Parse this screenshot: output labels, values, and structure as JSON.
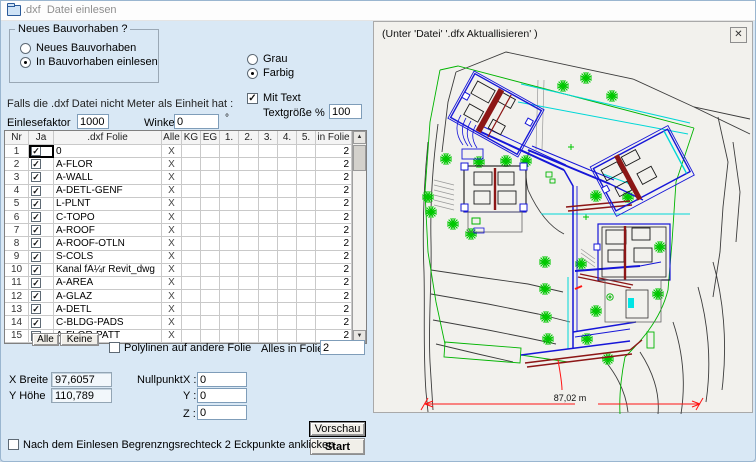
{
  "window": {
    "title": ".dxf  Datei einlesen"
  },
  "icons": {
    "check": "✓",
    "close": "✕",
    "scroll_up": "▲",
    "scroll_down": "▼",
    "folder": "folder-icon",
    "degree": "°"
  },
  "form": {
    "group_neues": {
      "legend": "Neues Bauvorhaben ?",
      "radio_neues": "Neues Bauvorhaben",
      "radio_einlesen": "In Bauvorhaben einlesen",
      "selected": "In Bauvorhaben einlesen"
    },
    "color": {
      "grau": "Grau",
      "farbig": "Farbig",
      "selected": "Farbig"
    },
    "mit_text": {
      "label": "Mit Text",
      "checked": true
    },
    "textgroesse": {
      "label": "Textgröße %",
      "value": "100"
    },
    "unit_note": "Falls die .dxf Datei nicht Meter als Einheit hat :",
    "einlesefaktor": {
      "label": "Einlesefaktor",
      "value": "1000"
    },
    "winkel": {
      "label": "Winkel",
      "value": "0",
      "unit": "°"
    }
  },
  "table": {
    "headers": [
      "Nr",
      "Ja",
      ".dxf Folie",
      "Alle",
      "KG",
      "EG",
      "1.",
      "2.",
      "3.",
      "4.",
      "5.",
      "in Folie"
    ],
    "rows": [
      {
        "nr": "1",
        "ja": true,
        "folie": "0",
        "alle": "X",
        "in_folie": "2"
      },
      {
        "nr": "2",
        "ja": true,
        "folie": "A-FLOR",
        "alle": "X",
        "in_folie": "2"
      },
      {
        "nr": "3",
        "ja": true,
        "folie": "A-WALL",
        "alle": "X",
        "in_folie": "2"
      },
      {
        "nr": "4",
        "ja": true,
        "folie": "A-DETL-GENF",
        "alle": "X",
        "in_folie": "2"
      },
      {
        "nr": "5",
        "ja": true,
        "folie": "L-PLNT",
        "alle": "X",
        "in_folie": "2"
      },
      {
        "nr": "6",
        "ja": true,
        "folie": "C-TOPO",
        "alle": "X",
        "in_folie": "2"
      },
      {
        "nr": "7",
        "ja": true,
        "folie": "A-ROOF",
        "alle": "X",
        "in_folie": "2"
      },
      {
        "nr": "8",
        "ja": true,
        "folie": "A-ROOF-OTLN",
        "alle": "X",
        "in_folie": "2"
      },
      {
        "nr": "9",
        "ja": true,
        "folie": "S-COLS",
        "alle": "X",
        "in_folie": "2"
      },
      {
        "nr": "10",
        "ja": true,
        "folie": "Kanal fÃ¼r Revit_dwg",
        "alle": "X",
        "in_folie": "2"
      },
      {
        "nr": "11",
        "ja": true,
        "folie": "A-AREA",
        "alle": "X",
        "in_folie": "2"
      },
      {
        "nr": "12",
        "ja": true,
        "folie": "A-GLAZ",
        "alle": "X",
        "in_folie": "2"
      },
      {
        "nr": "13",
        "ja": true,
        "folie": "A-DETL",
        "alle": "X",
        "in_folie": "2"
      },
      {
        "nr": "14",
        "ja": true,
        "folie": "C-BLDG-PADS",
        "alle": "X",
        "in_folie": "2"
      },
      {
        "nr": "15",
        "ja": true,
        "folie": "A-FLOR-PATT",
        "alle": "X",
        "in_folie": "2"
      }
    ]
  },
  "actions": {
    "alle": "Alle",
    "keine": "Keine",
    "polylinen": "Polylinen auf andere Folie",
    "polylinen_checked": false,
    "alles_label": "Alles in Folie Nr.",
    "alles_value": "2",
    "vorschau": "Vorschau",
    "start": "Start",
    "bottom_check": "Nach dem Einlesen Begrenzngsrechteck  2 Eckpunkte anklicken",
    "bottom_check_checked": false
  },
  "measures": {
    "x_breite": {
      "label": "X Breite",
      "value": "97,6057"
    },
    "y_hoehe": {
      "label": "Y Höhe",
      "value": "110,789"
    },
    "nullpunkt": {
      "label": "Nullpunkt",
      "x_label": "X :",
      "y_label": "Y :",
      "z_label": "Z :",
      "x": "0",
      "y": "0",
      "z": "0"
    }
  },
  "preview": {
    "title": "(Unter 'Datei' '.dfx Aktuallisieren' )",
    "dimension_label": "87,02 m",
    "colors": {
      "boundary_green": "#00b400",
      "tree_green": "#00c800",
      "building_blue": "#1616d8",
      "utility_cyan": "#00d7d7",
      "stair_darkred": "#8c1616",
      "dimension_red": "#ff1414",
      "contour_gray": "#3c3c3c"
    }
  }
}
